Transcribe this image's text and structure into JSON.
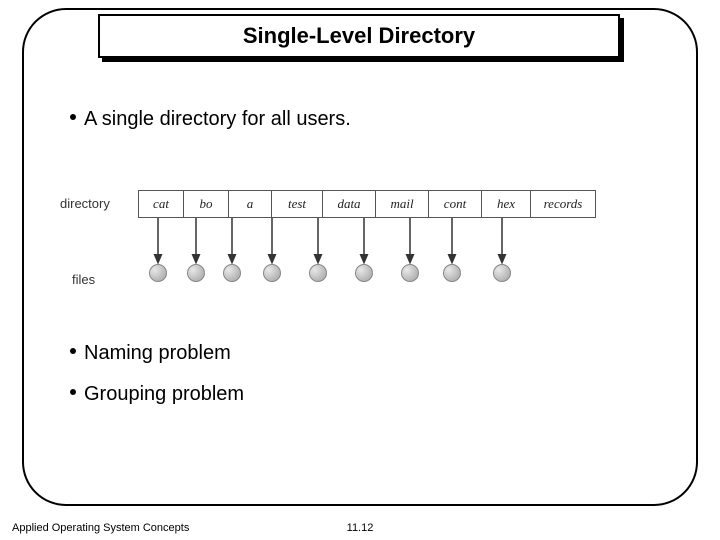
{
  "title": "Single-Level Directory",
  "bullets": {
    "main": "A single directory for all users.",
    "p1": "Naming problem",
    "p2": "Grouping problem"
  },
  "diagram": {
    "label_directory": "directory",
    "label_files": "files",
    "entries": [
      "cat",
      "bo",
      "a",
      "test",
      "data",
      "mail",
      "cont",
      "hex",
      "records"
    ]
  },
  "footer": {
    "left": "Applied Operating System Concepts",
    "center": "11.12"
  },
  "chart_data": {
    "type": "table",
    "description": "Single-level directory structure: one row of directory entries, each pointing to one file node.",
    "directory_entries": [
      "cat",
      "bo",
      "a",
      "test",
      "data",
      "mail",
      "cont",
      "hex",
      "records"
    ],
    "files_count": 9
  }
}
